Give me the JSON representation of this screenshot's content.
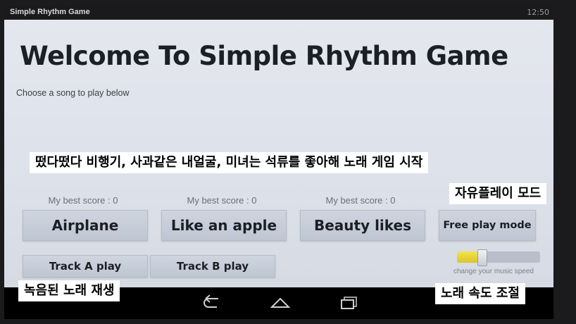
{
  "statusbar": {
    "app_title": "Simple Rhythm Game",
    "clock": "12:50"
  },
  "header": {
    "title": "Welcome To Simple Rhythm Game",
    "subtitle": "Choose a song to play below"
  },
  "songs": [
    {
      "score_label": "My best score : 0",
      "button_label": "Airplane"
    },
    {
      "score_label": "My best score : 0",
      "button_label": "Like an apple"
    },
    {
      "score_label": "My best score : 0",
      "button_label": "Beauty likes"
    }
  ],
  "free_play": {
    "button_label": "Free play mode"
  },
  "tracks": {
    "track_a_label": "Track A play",
    "track_b_label": "Track B play"
  },
  "speed_slider": {
    "label": "change your music speed",
    "value_fraction": 0.3
  },
  "navbar": {
    "icons": [
      "back-icon",
      "home-icon",
      "recent-apps-icon"
    ]
  },
  "annotations": {
    "songs_caption": "떴다떴다 비행기, 사과같은 내얼굴, 미녀는 석류를 좋아해 노래 게임 시작",
    "free_play_caption": "자유플레이 모드",
    "recording_caption": "녹음된 노래 재생",
    "speed_caption": "노래 속도 조절"
  },
  "colors": {
    "slider_fill": "#e8d63a",
    "button_bg": "#c7cdd8",
    "screen_bg": "#dfe2ea"
  }
}
